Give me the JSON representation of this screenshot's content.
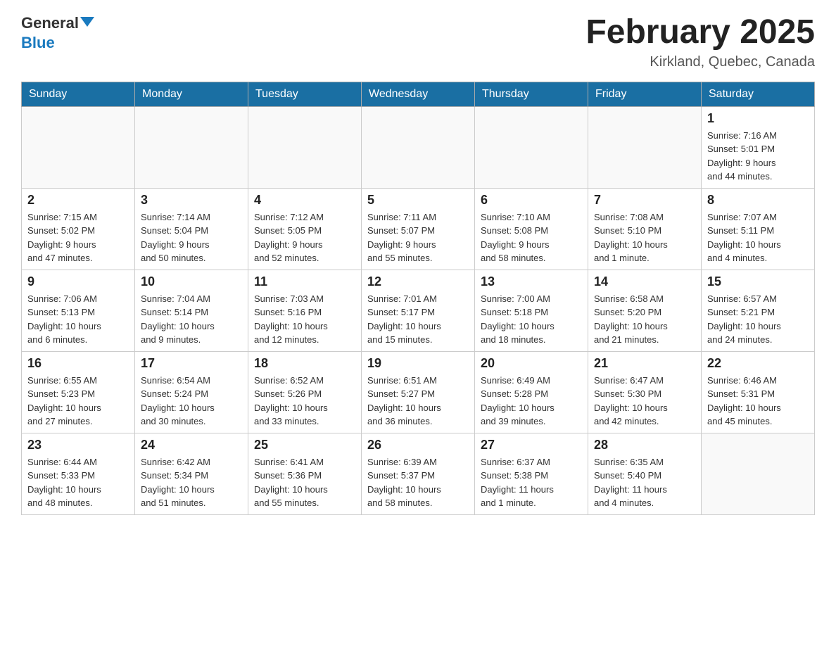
{
  "logo": {
    "general": "General",
    "blue": "Blue"
  },
  "title": {
    "month_year": "February 2025",
    "location": "Kirkland, Quebec, Canada"
  },
  "days_of_week": [
    "Sunday",
    "Monday",
    "Tuesday",
    "Wednesday",
    "Thursday",
    "Friday",
    "Saturday"
  ],
  "weeks": [
    [
      {
        "day": "",
        "info": ""
      },
      {
        "day": "",
        "info": ""
      },
      {
        "day": "",
        "info": ""
      },
      {
        "day": "",
        "info": ""
      },
      {
        "day": "",
        "info": ""
      },
      {
        "day": "",
        "info": ""
      },
      {
        "day": "1",
        "info": "Sunrise: 7:16 AM\nSunset: 5:01 PM\nDaylight: 9 hours\nand 44 minutes."
      }
    ],
    [
      {
        "day": "2",
        "info": "Sunrise: 7:15 AM\nSunset: 5:02 PM\nDaylight: 9 hours\nand 47 minutes."
      },
      {
        "day": "3",
        "info": "Sunrise: 7:14 AM\nSunset: 5:04 PM\nDaylight: 9 hours\nand 50 minutes."
      },
      {
        "day": "4",
        "info": "Sunrise: 7:12 AM\nSunset: 5:05 PM\nDaylight: 9 hours\nand 52 minutes."
      },
      {
        "day": "5",
        "info": "Sunrise: 7:11 AM\nSunset: 5:07 PM\nDaylight: 9 hours\nand 55 minutes."
      },
      {
        "day": "6",
        "info": "Sunrise: 7:10 AM\nSunset: 5:08 PM\nDaylight: 9 hours\nand 58 minutes."
      },
      {
        "day": "7",
        "info": "Sunrise: 7:08 AM\nSunset: 5:10 PM\nDaylight: 10 hours\nand 1 minute."
      },
      {
        "day": "8",
        "info": "Sunrise: 7:07 AM\nSunset: 5:11 PM\nDaylight: 10 hours\nand 4 minutes."
      }
    ],
    [
      {
        "day": "9",
        "info": "Sunrise: 7:06 AM\nSunset: 5:13 PM\nDaylight: 10 hours\nand 6 minutes."
      },
      {
        "day": "10",
        "info": "Sunrise: 7:04 AM\nSunset: 5:14 PM\nDaylight: 10 hours\nand 9 minutes."
      },
      {
        "day": "11",
        "info": "Sunrise: 7:03 AM\nSunset: 5:16 PM\nDaylight: 10 hours\nand 12 minutes."
      },
      {
        "day": "12",
        "info": "Sunrise: 7:01 AM\nSunset: 5:17 PM\nDaylight: 10 hours\nand 15 minutes."
      },
      {
        "day": "13",
        "info": "Sunrise: 7:00 AM\nSunset: 5:18 PM\nDaylight: 10 hours\nand 18 minutes."
      },
      {
        "day": "14",
        "info": "Sunrise: 6:58 AM\nSunset: 5:20 PM\nDaylight: 10 hours\nand 21 minutes."
      },
      {
        "day": "15",
        "info": "Sunrise: 6:57 AM\nSunset: 5:21 PM\nDaylight: 10 hours\nand 24 minutes."
      }
    ],
    [
      {
        "day": "16",
        "info": "Sunrise: 6:55 AM\nSunset: 5:23 PM\nDaylight: 10 hours\nand 27 minutes."
      },
      {
        "day": "17",
        "info": "Sunrise: 6:54 AM\nSunset: 5:24 PM\nDaylight: 10 hours\nand 30 minutes."
      },
      {
        "day": "18",
        "info": "Sunrise: 6:52 AM\nSunset: 5:26 PM\nDaylight: 10 hours\nand 33 minutes."
      },
      {
        "day": "19",
        "info": "Sunrise: 6:51 AM\nSunset: 5:27 PM\nDaylight: 10 hours\nand 36 minutes."
      },
      {
        "day": "20",
        "info": "Sunrise: 6:49 AM\nSunset: 5:28 PM\nDaylight: 10 hours\nand 39 minutes."
      },
      {
        "day": "21",
        "info": "Sunrise: 6:47 AM\nSunset: 5:30 PM\nDaylight: 10 hours\nand 42 minutes."
      },
      {
        "day": "22",
        "info": "Sunrise: 6:46 AM\nSunset: 5:31 PM\nDaylight: 10 hours\nand 45 minutes."
      }
    ],
    [
      {
        "day": "23",
        "info": "Sunrise: 6:44 AM\nSunset: 5:33 PM\nDaylight: 10 hours\nand 48 minutes."
      },
      {
        "day": "24",
        "info": "Sunrise: 6:42 AM\nSunset: 5:34 PM\nDaylight: 10 hours\nand 51 minutes."
      },
      {
        "day": "25",
        "info": "Sunrise: 6:41 AM\nSunset: 5:36 PM\nDaylight: 10 hours\nand 55 minutes."
      },
      {
        "day": "26",
        "info": "Sunrise: 6:39 AM\nSunset: 5:37 PM\nDaylight: 10 hours\nand 58 minutes."
      },
      {
        "day": "27",
        "info": "Sunrise: 6:37 AM\nSunset: 5:38 PM\nDaylight: 11 hours\nand 1 minute."
      },
      {
        "day": "28",
        "info": "Sunrise: 6:35 AM\nSunset: 5:40 PM\nDaylight: 11 hours\nand 4 minutes."
      },
      {
        "day": "",
        "info": ""
      }
    ]
  ]
}
